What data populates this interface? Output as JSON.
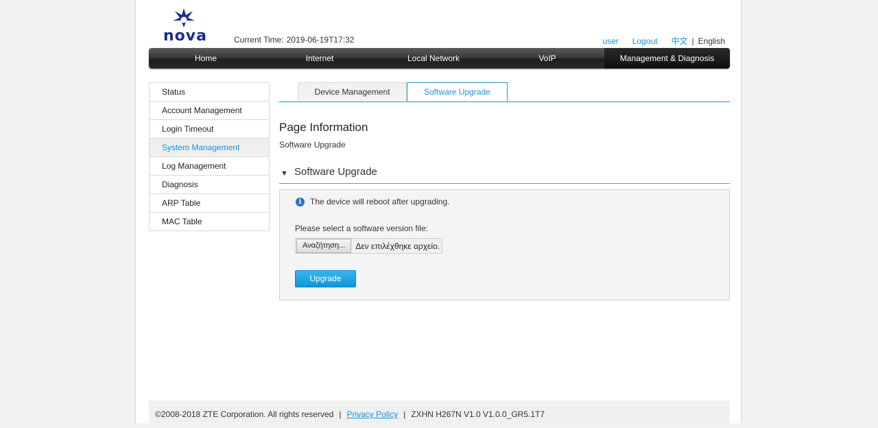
{
  "brand": {
    "logo_text": "nova"
  },
  "header": {
    "current_time_label": "Current Time:",
    "current_time_value": "2019-06-19T17:32",
    "user_link": "user",
    "logout_link": "Logout",
    "lang_zh": "中文",
    "lang_sep": "|",
    "lang_en": "English"
  },
  "nav": {
    "items": [
      "Home",
      "Internet",
      "Local Network",
      "VoIP",
      "Management & Diagnosis"
    ]
  },
  "sidebar": {
    "items": [
      "Status",
      "Account Management",
      "Login Timeout",
      "System Management",
      "Log Management",
      "Diagnosis",
      "ARP Table",
      "MAC Table"
    ],
    "active": "System Management"
  },
  "tabs": {
    "items": [
      "Device Management",
      "Software Upgrade"
    ],
    "active": "Software Upgrade"
  },
  "page_info": {
    "title": "Page Information",
    "subtitle": "Software Upgrade"
  },
  "section": {
    "title": "Software Upgrade",
    "notice": "The device will reboot after upgrading.",
    "select_label": "Please select a software version file:",
    "browse_label": "Αναζήτηση...",
    "file_status": "Δεν επιλέχθηκε αρχείο.",
    "upgrade_button": "Upgrade"
  },
  "footer": {
    "copyright": "©2008-2018 ZTE Corporation. All rights reserved",
    "sep": "|",
    "privacy_link": "Privacy Policy",
    "version": "ZXHN H267N V1.0 V1.0.0_GR5.1T7"
  },
  "colors": {
    "accent": "#1e90d6",
    "nav_dark": "#2a2a2a",
    "logo_blue": "#1a2f8a"
  }
}
